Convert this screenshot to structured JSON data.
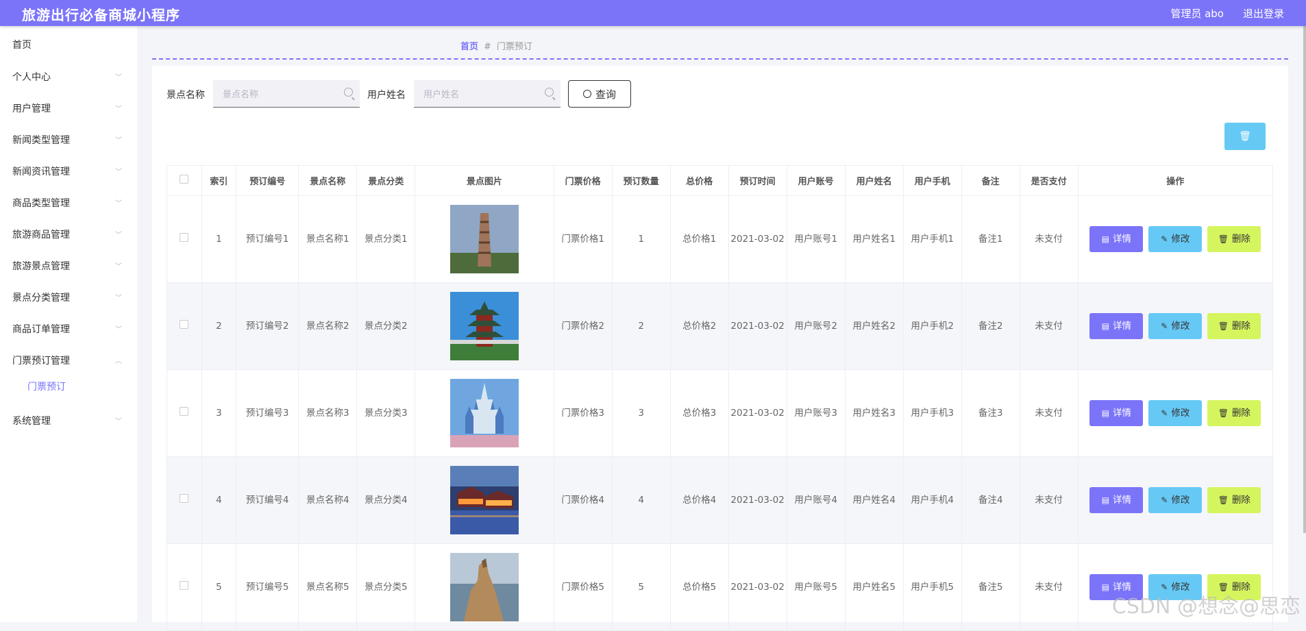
{
  "header": {
    "title": "旅游出行必备商城小程序",
    "user": "管理员 abo",
    "logout": "退出登录"
  },
  "sidebar": {
    "items": [
      {
        "label": "首页",
        "chevron": false
      },
      {
        "label": "个人中心",
        "chevron": "down"
      },
      {
        "label": "用户管理",
        "chevron": "down"
      },
      {
        "label": "新闻类型管理",
        "chevron": "down"
      },
      {
        "label": "新闻资讯管理",
        "chevron": "down"
      },
      {
        "label": "商品类型管理",
        "chevron": "down"
      },
      {
        "label": "旅游商品管理",
        "chevron": "down"
      },
      {
        "label": "旅游景点管理",
        "chevron": "down"
      },
      {
        "label": "景点分类管理",
        "chevron": "down"
      },
      {
        "label": "商品订单管理",
        "chevron": "down"
      },
      {
        "label": "门票预订管理",
        "chevron": "up"
      },
      {
        "label": "系统管理",
        "chevron": "down"
      }
    ],
    "sub_item": "门票预订"
  },
  "breadcrumb": {
    "home": "首页",
    "sep": "#",
    "current": "门票预订"
  },
  "search": {
    "scenic_label": "景点名称",
    "scenic_placeholder": "景点名称",
    "user_label": "用户姓名",
    "user_placeholder": "用户姓名",
    "query_label": "查询"
  },
  "table": {
    "headers": [
      "",
      "索引",
      "预订编号",
      "景点名称",
      "景点分类",
      "景点图片",
      "门票价格",
      "预订数量",
      "总价格",
      "预订时间",
      "用户账号",
      "用户姓名",
      "用户手机",
      "备注",
      "是否支付",
      "操作"
    ],
    "rows": [
      {
        "index": "1",
        "order_no": "预订编号1",
        "name": "景点名称1",
        "category": "景点分类1",
        "price": "门票价格1",
        "qty": "1",
        "total": "总价格1",
        "time": "2021-03-02",
        "account": "用户账号1",
        "uname": "用户姓名1",
        "phone": "用户手机1",
        "note": "备注1",
        "paid": "未支付",
        "img": "tower"
      },
      {
        "index": "2",
        "order_no": "预订编号2",
        "name": "景点名称2",
        "category": "景点分类2",
        "price": "门票价格2",
        "qty": "2",
        "total": "总价格2",
        "time": "2021-03-02",
        "account": "用户账号2",
        "uname": "用户姓名2",
        "phone": "用户手机2",
        "note": "备注2",
        "paid": "未支付",
        "img": "pagoda"
      },
      {
        "index": "3",
        "order_no": "预订编号3",
        "name": "景点名称3",
        "category": "景点分类3",
        "price": "门票价格3",
        "qty": "3",
        "total": "总价格3",
        "time": "2021-03-02",
        "account": "用户账号3",
        "uname": "用户姓名3",
        "phone": "用户手机3",
        "note": "备注3",
        "paid": "未支付",
        "img": "castle"
      },
      {
        "index": "4",
        "order_no": "预订编号4",
        "name": "景点名称4",
        "category": "景点分类4",
        "price": "门票价格4",
        "qty": "4",
        "total": "总价格4",
        "time": "2021-03-02",
        "account": "用户账号4",
        "uname": "用户姓名4",
        "phone": "用户手机4",
        "note": "备注4",
        "paid": "未支付",
        "img": "watertown"
      },
      {
        "index": "5",
        "order_no": "预订编号5",
        "name": "景点名称5",
        "category": "景点分类5",
        "price": "门票价格5",
        "qty": "5",
        "total": "总价格5",
        "time": "2021-03-02",
        "account": "用户账号5",
        "uname": "用户姓名5",
        "phone": "用户手机5",
        "note": "备注5",
        "paid": "未支付",
        "img": "cliff"
      }
    ],
    "actions": {
      "detail": "详情",
      "edit": "修改",
      "delete": "删除"
    }
  },
  "watermark": "CSDN @想念@思恋",
  "colors": {
    "accent": "#7b74f8",
    "edit": "#66c9f5",
    "delete": "#d5f55e"
  }
}
